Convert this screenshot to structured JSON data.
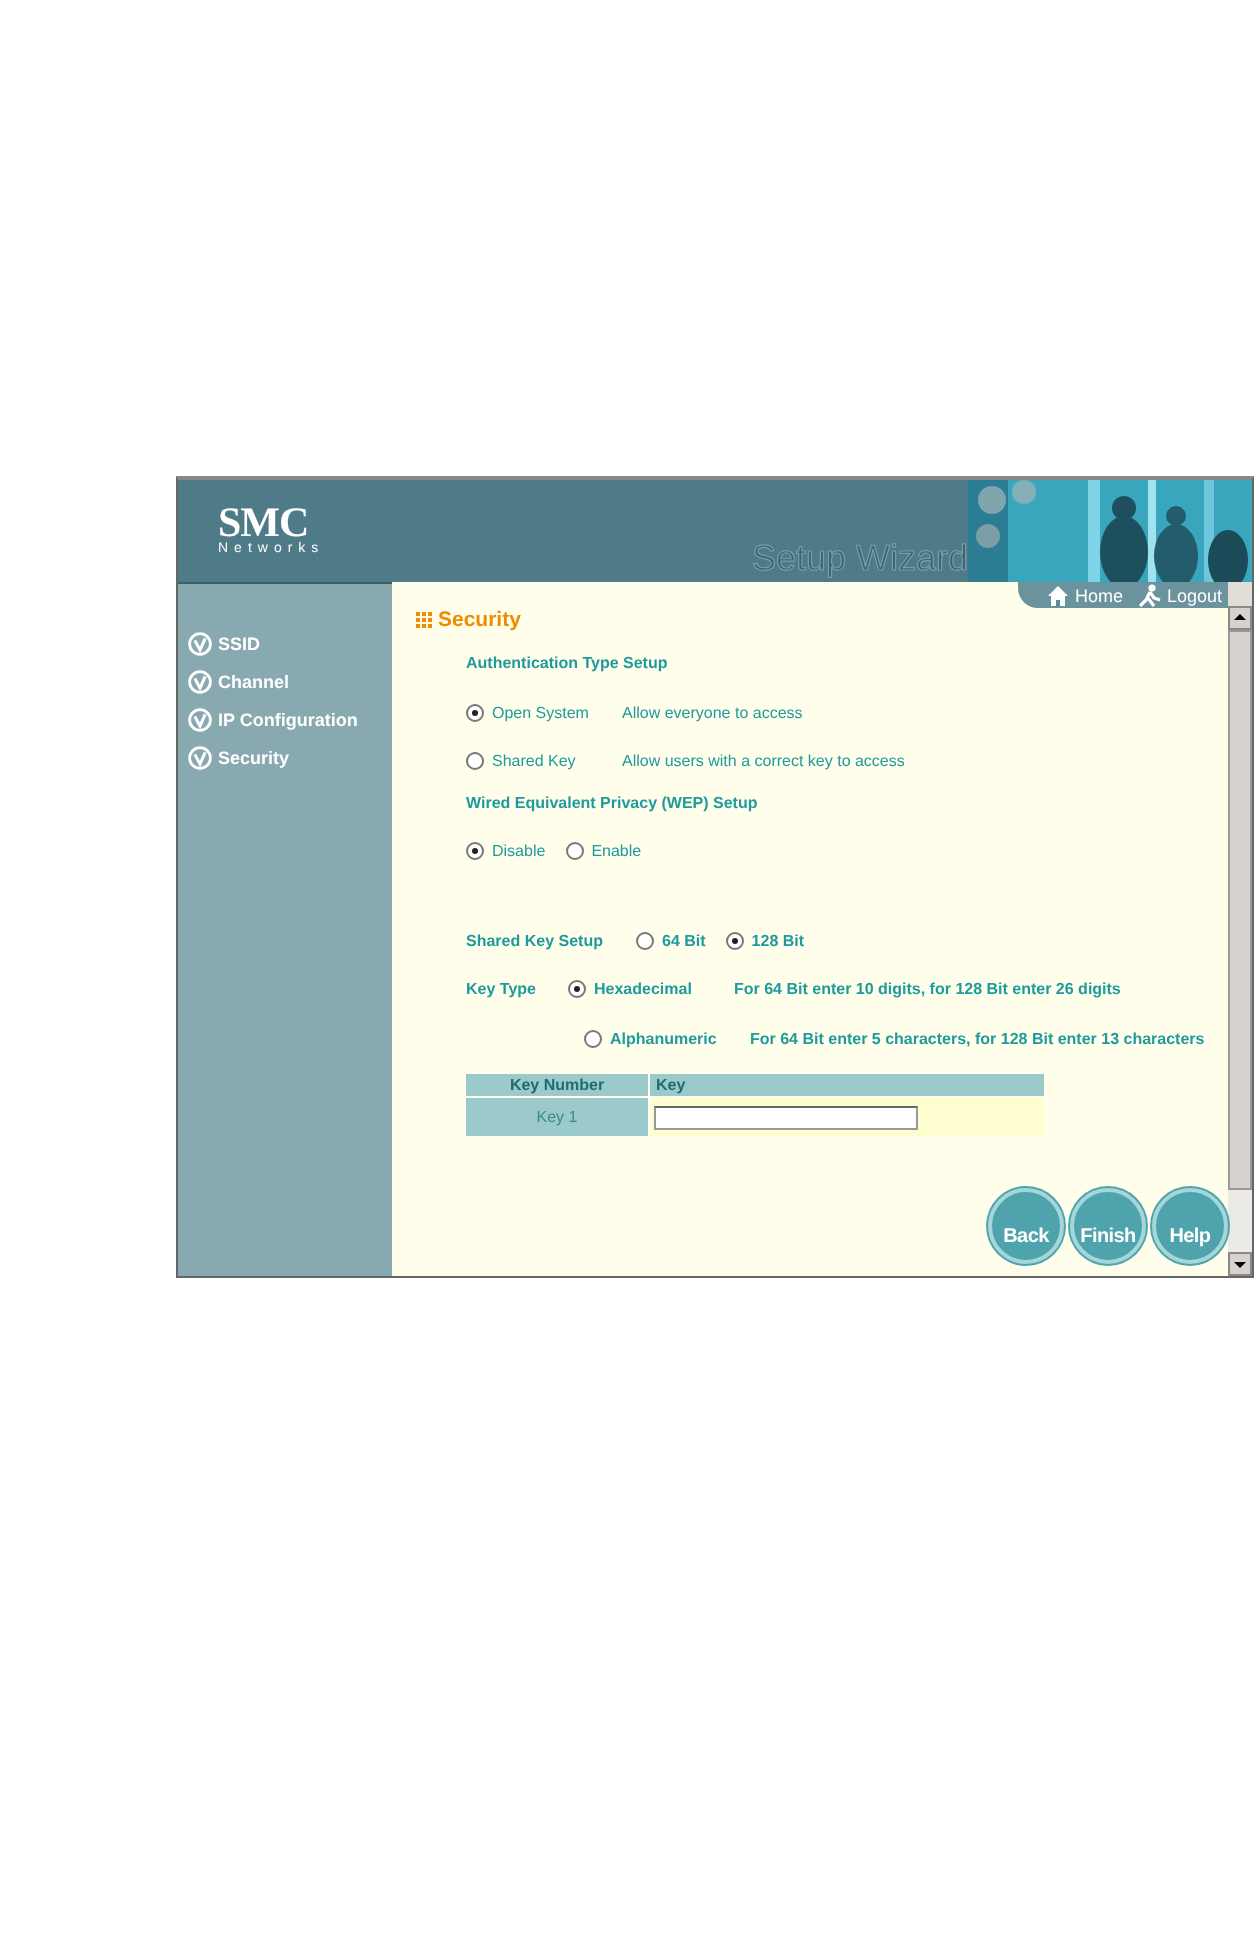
{
  "header": {
    "logo": "SMC",
    "logo_sub": "Networks",
    "title": "Setup Wizard"
  },
  "nav_links": [
    {
      "label": "Home"
    },
    {
      "label": "Logout"
    }
  ],
  "sidebar": {
    "items": [
      {
        "label": "SSID"
      },
      {
        "label": "Channel"
      },
      {
        "label": "IP Configuration"
      },
      {
        "label": "Security"
      }
    ]
  },
  "page_title": "Security",
  "auth": {
    "heading": "Authentication Type Setup",
    "options": [
      {
        "label": "Open System",
        "description": "Allow everyone to access",
        "selected": true
      },
      {
        "label": "Shared Key",
        "description": "Allow users with a correct key to access",
        "selected": false
      }
    ]
  },
  "wep": {
    "heading": "Wired Equivalent Privacy (WEP) Setup",
    "options": [
      {
        "label": "Disable",
        "selected": true
      },
      {
        "label": "Enable",
        "selected": false
      }
    ]
  },
  "shared_key": {
    "label": "Shared Key Setup",
    "options": [
      {
        "label": "64 Bit",
        "selected": false
      },
      {
        "label": "128 Bit",
        "selected": true
      }
    ]
  },
  "key_type": {
    "label": "Key Type",
    "options": [
      {
        "label": "Hexadecimal",
        "description": "For 64 Bit enter 10 digits, for 128 Bit enter 26 digits",
        "selected": true
      },
      {
        "label": "Alphanumeric",
        "description": "For 64 Bit enter 5 characters, for 128 Bit enter 13 characters",
        "selected": false
      }
    ]
  },
  "key_table": {
    "columns": [
      "Key Number",
      "Key"
    ],
    "rows": [
      {
        "key_number": "Key 1"
      }
    ]
  },
  "buttons": [
    "Back",
    "Finish",
    "Help"
  ]
}
